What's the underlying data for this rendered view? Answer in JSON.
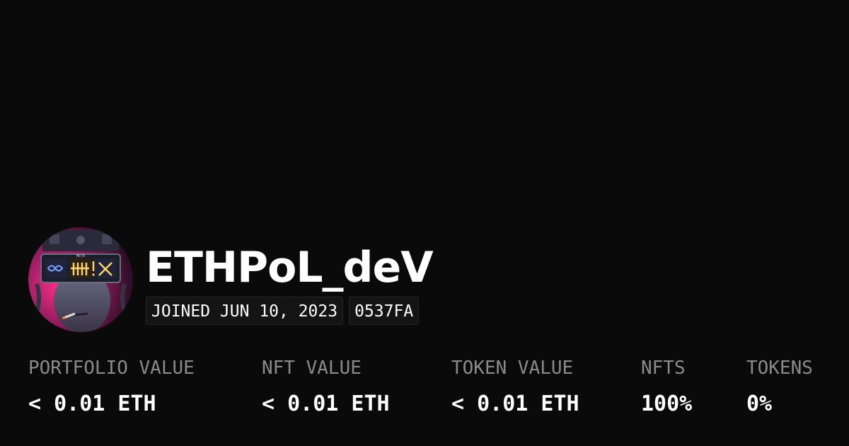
{
  "profile": {
    "username": "ETHPoL_deV",
    "avatar_icon": "cyberpunk-visor-avatar",
    "joined": "JOINED JUN 10, 2023",
    "address_short": "0537FA",
    "avatar_text": "META"
  },
  "stats": {
    "portfolio_value": {
      "label": "PORTFOLIO VALUE",
      "value": "< 0.01 ETH"
    },
    "nft_value": {
      "label": "NFT VALUE",
      "value": "< 0.01 ETH"
    },
    "token_value": {
      "label": "TOKEN VALUE",
      "value": "< 0.01 ETH"
    },
    "nfts": {
      "label": "NFTS",
      "value": "100%"
    },
    "tokens": {
      "label": "TOKENS",
      "value": "0%"
    }
  },
  "colors": {
    "background": "#0a0a0a",
    "label": "#8a8a8a",
    "value": "#ffffff",
    "badge_bg": "#141414",
    "avatar_accent": "#ff2e88",
    "avatar_glow": "#ffd36b"
  }
}
